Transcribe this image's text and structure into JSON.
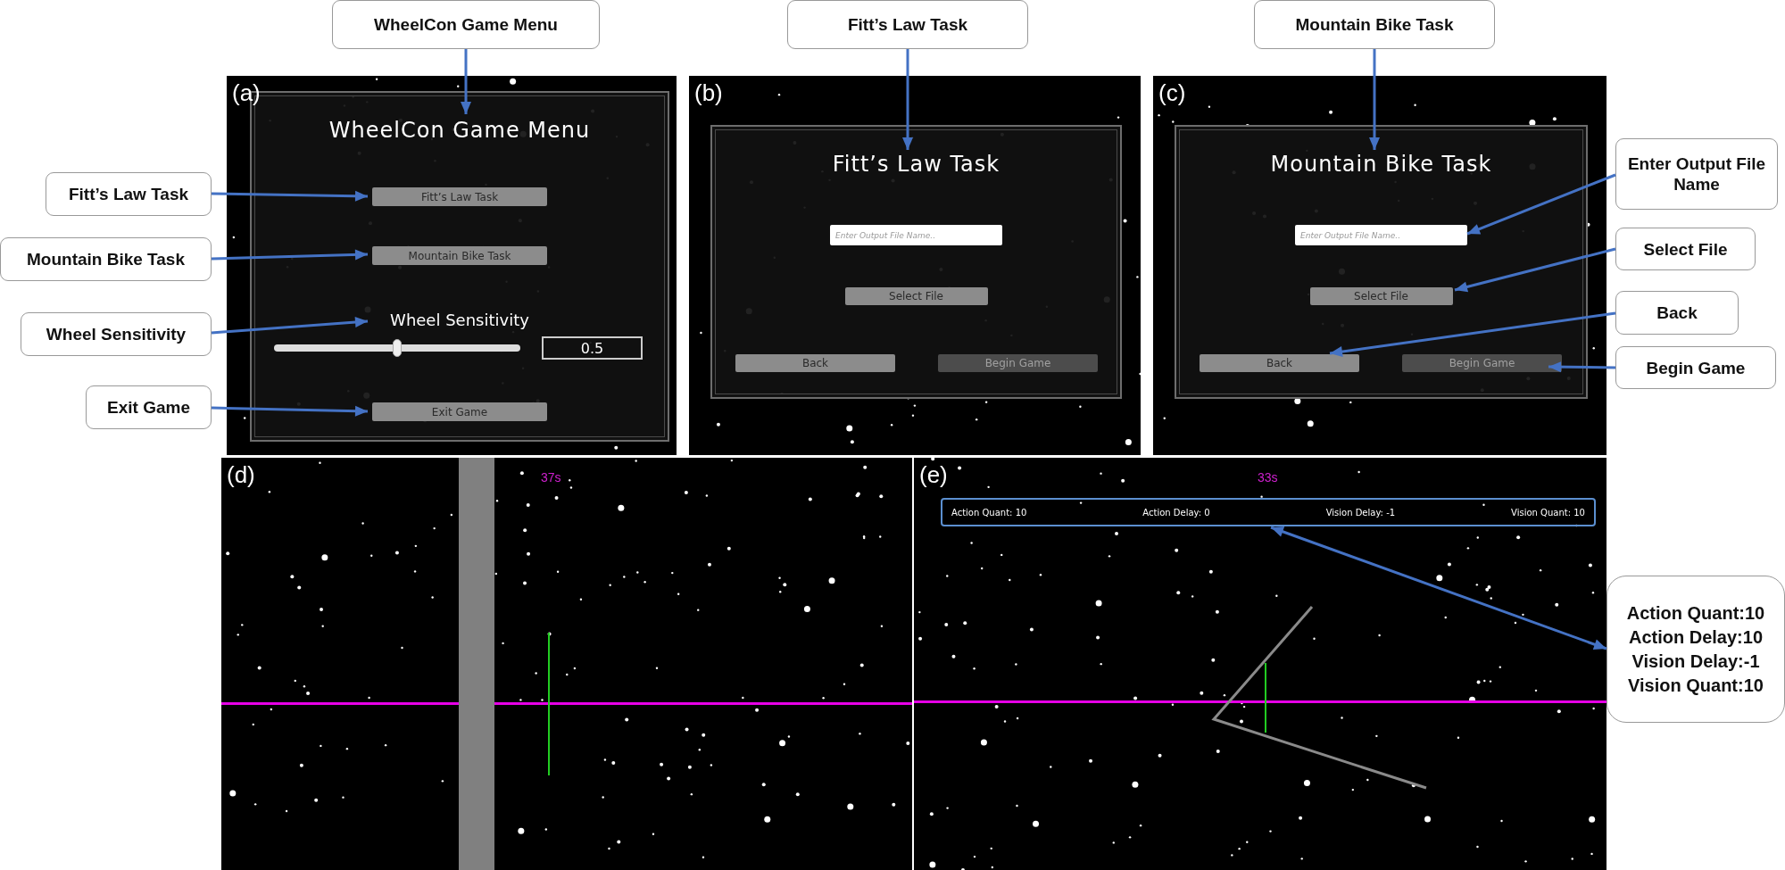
{
  "panels": [
    {
      "kind": "main_menu",
      "tag": "(a)",
      "title": "WheelCon Game Menu",
      "buttons": [
        "Fitt’s Law Task",
        "Mountain Bike Task"
      ],
      "slider": {
        "label": "Wheel Sensitivity",
        "level": 0.5,
        "value": "0.5"
      },
      "exit_button": "Exit Game"
    },
    {
      "kind": "task_setup",
      "tag": "(b)",
      "title": "Fitt’s Law Task",
      "placeholder": "Enter Output File Name..",
      "select_button": "Select File",
      "back_button": {
        "label": "Back",
        "disabled": false
      },
      "begin_button": {
        "label": "Begin Game",
        "disabled": true
      }
    },
    {
      "kind": "task_setup",
      "tag": "(c)",
      "title": "Mountain Bike Task",
      "placeholder": "Enter Output File Name..",
      "select_button": "Select File",
      "back_button": {
        "label": "Back",
        "disabled": false
      },
      "begin_button": {
        "label": "Begin Game",
        "disabled": true
      }
    },
    {
      "kind": "fitts_game",
      "tag": "(d)",
      "timer": "37s"
    },
    {
      "kind": "bike_game",
      "tag": "(e)",
      "timer": "33s",
      "hud": [
        "Action Quant: 10",
        "Action Delay: 0",
        "Vision Delay: -1",
        "Vision Quant: 10"
      ]
    }
  ],
  "callouts": [
    {
      "text": "WheelCon Game Menu"
    },
    {
      "text": "Fitt’s Law Task"
    },
    {
      "text": "Mountain Bike Task"
    },
    {
      "text": "Wheel Sensitivity"
    },
    {
      "text": "Exit Game"
    },
    {
      "text": "Fitt’s Law Task"
    },
    {
      "text": "Mountain Bike Task"
    },
    {
      "text": "Enter Output File Name"
    },
    {
      "text": "Select File"
    },
    {
      "text": "Back"
    },
    {
      "text": "Begin Game"
    }
  ],
  "hud_callout": {
    "lines": [
      "Action Quant:10",
      "Action Delay:10",
      "Vision Delay:-1",
      "Vision Quant:10"
    ]
  }
}
